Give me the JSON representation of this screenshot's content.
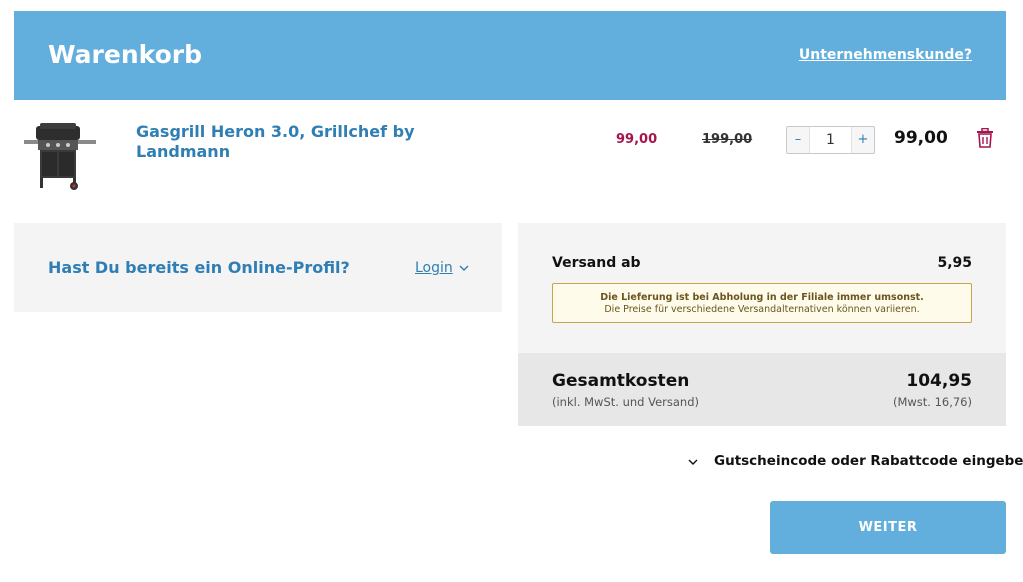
{
  "header": {
    "title": "Warenkorb",
    "business_link": "Unternehmenskunde?"
  },
  "cart": {
    "items": [
      {
        "name": "Gasgrill Heron 3.0, Grillchef by Landmann",
        "image_icon": "gas-grill-image",
        "sale_price": "99,00",
        "original_price": "199,00",
        "quantity": "1",
        "line_total": "99,00"
      }
    ],
    "qty_minus": "–",
    "qty_plus": "+"
  },
  "login_box": {
    "question": "Hast Du bereits ein Online-Profil?",
    "login_label": "Login"
  },
  "shipping": {
    "label": "Versand ab",
    "amount": "5,95",
    "notice_line1": "Die Lieferung ist bei Abholung in der Filiale immer umsonst.",
    "notice_line2": "Die Preise für verschiedene Versandalternativen können variieren."
  },
  "total": {
    "label": "Gesamtkosten",
    "sublabel": "(inkl. MwSt. und Versand)",
    "amount": "104,95",
    "tax": "(Mwst. 16,76)"
  },
  "voucher": {
    "label": "Gutscheincode oder Rabattcode eingeben"
  },
  "actions": {
    "next_label": "WEITER"
  },
  "colors": {
    "accent": "#62aedc",
    "link": "#2f7fb4",
    "sale": "#a3154c"
  }
}
